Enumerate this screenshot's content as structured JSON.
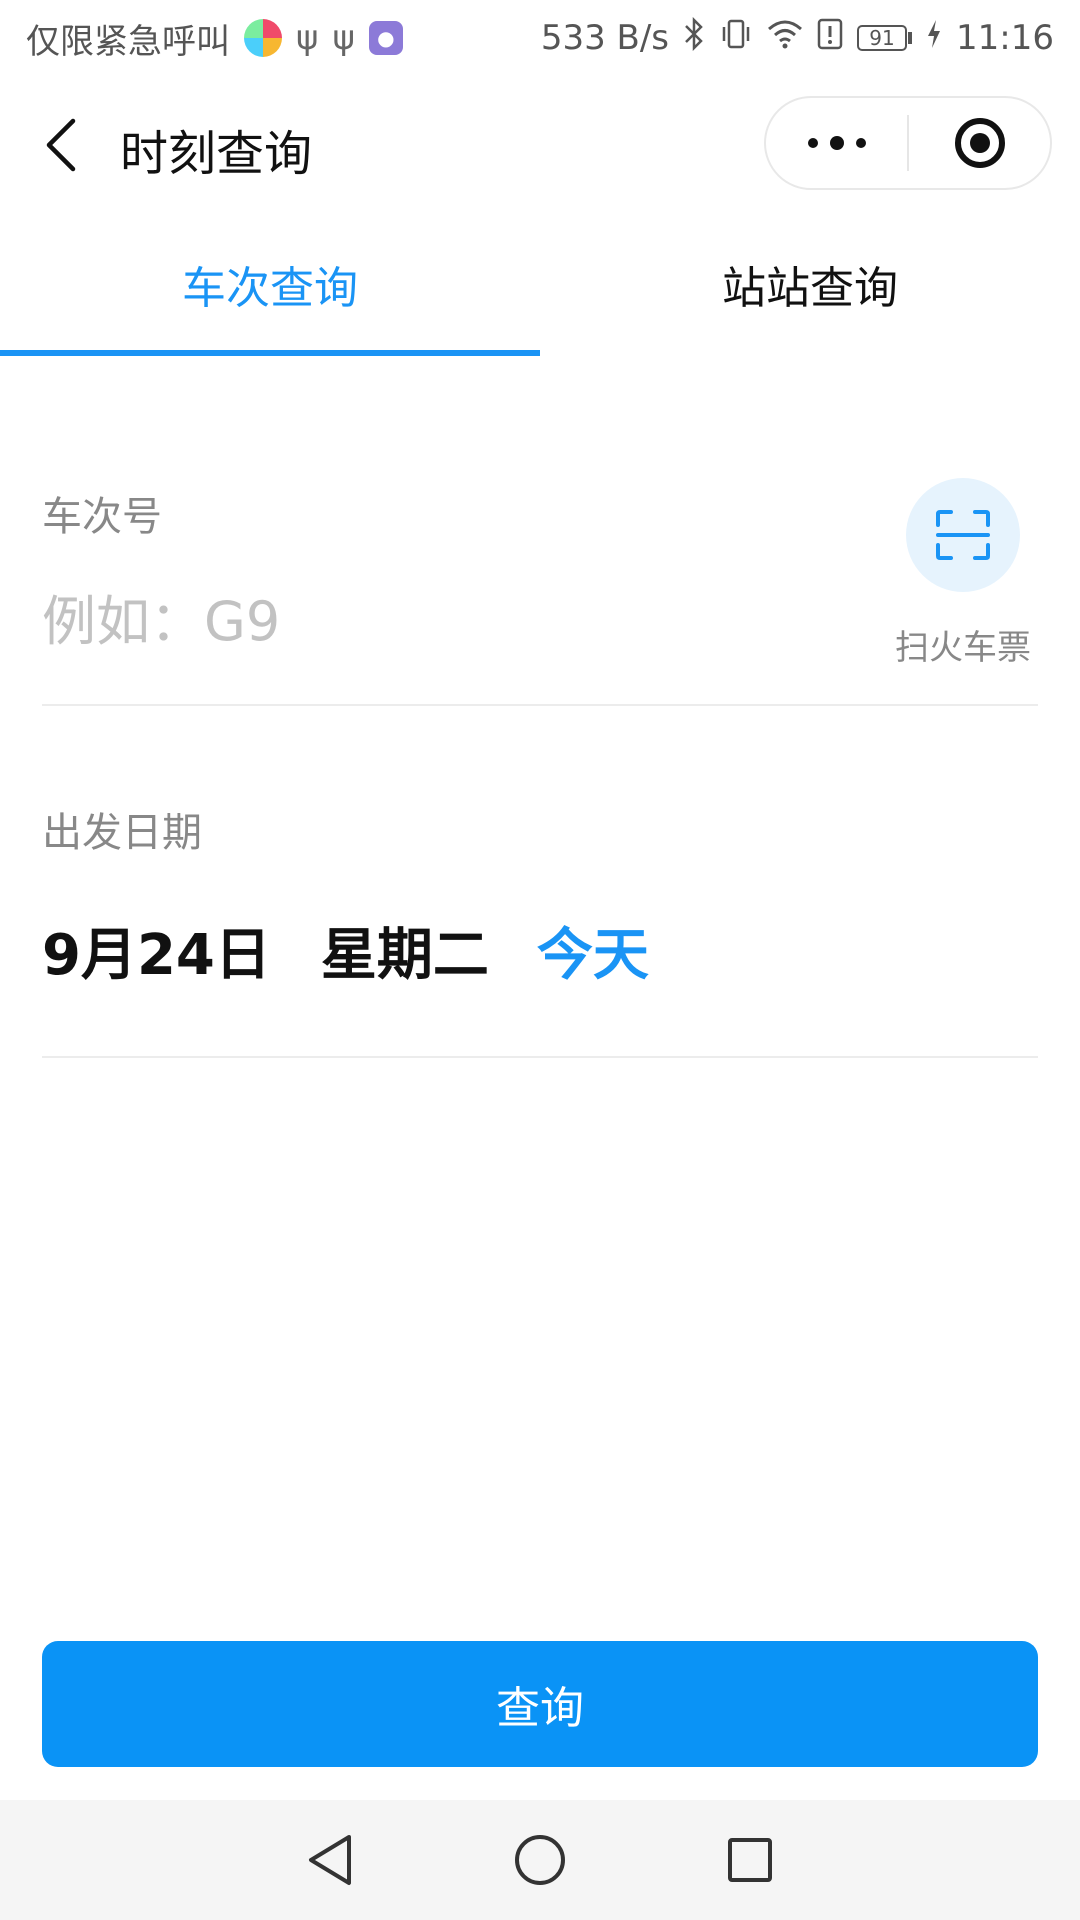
{
  "status_bar": {
    "carrier_text": "仅限紧急呼叫",
    "network_speed": "533 B/s",
    "battery_level": "91",
    "time": "11:16",
    "icons": [
      "app-icon",
      "usb-icon",
      "usb-icon",
      "app-icon",
      "bluetooth-icon",
      "vibrate-icon",
      "wifi-icon",
      "alert-icon",
      "battery-icon",
      "charging-icon"
    ]
  },
  "nav": {
    "title": "时刻查询",
    "icons": [
      "back-icon",
      "more-icon",
      "close-target-icon"
    ]
  },
  "tabs": [
    {
      "label": "车次查询",
      "active": true
    },
    {
      "label": "站站查询",
      "active": false
    }
  ],
  "train_field": {
    "label": "车次号",
    "placeholder": "例如：G9",
    "value": "",
    "scan_label": "扫火车票"
  },
  "date_field": {
    "label": "出发日期",
    "date": "9月24日",
    "weekday": "星期二",
    "relative": "今天"
  },
  "query_button": {
    "label": "查询"
  },
  "colors": {
    "accent": "#1a94f5",
    "button": "#0a93f6",
    "scan_bg": "#e6f3fd"
  },
  "system_nav": {
    "icons": [
      "back-triangle-icon",
      "home-circle-icon",
      "recents-square-icon"
    ]
  }
}
